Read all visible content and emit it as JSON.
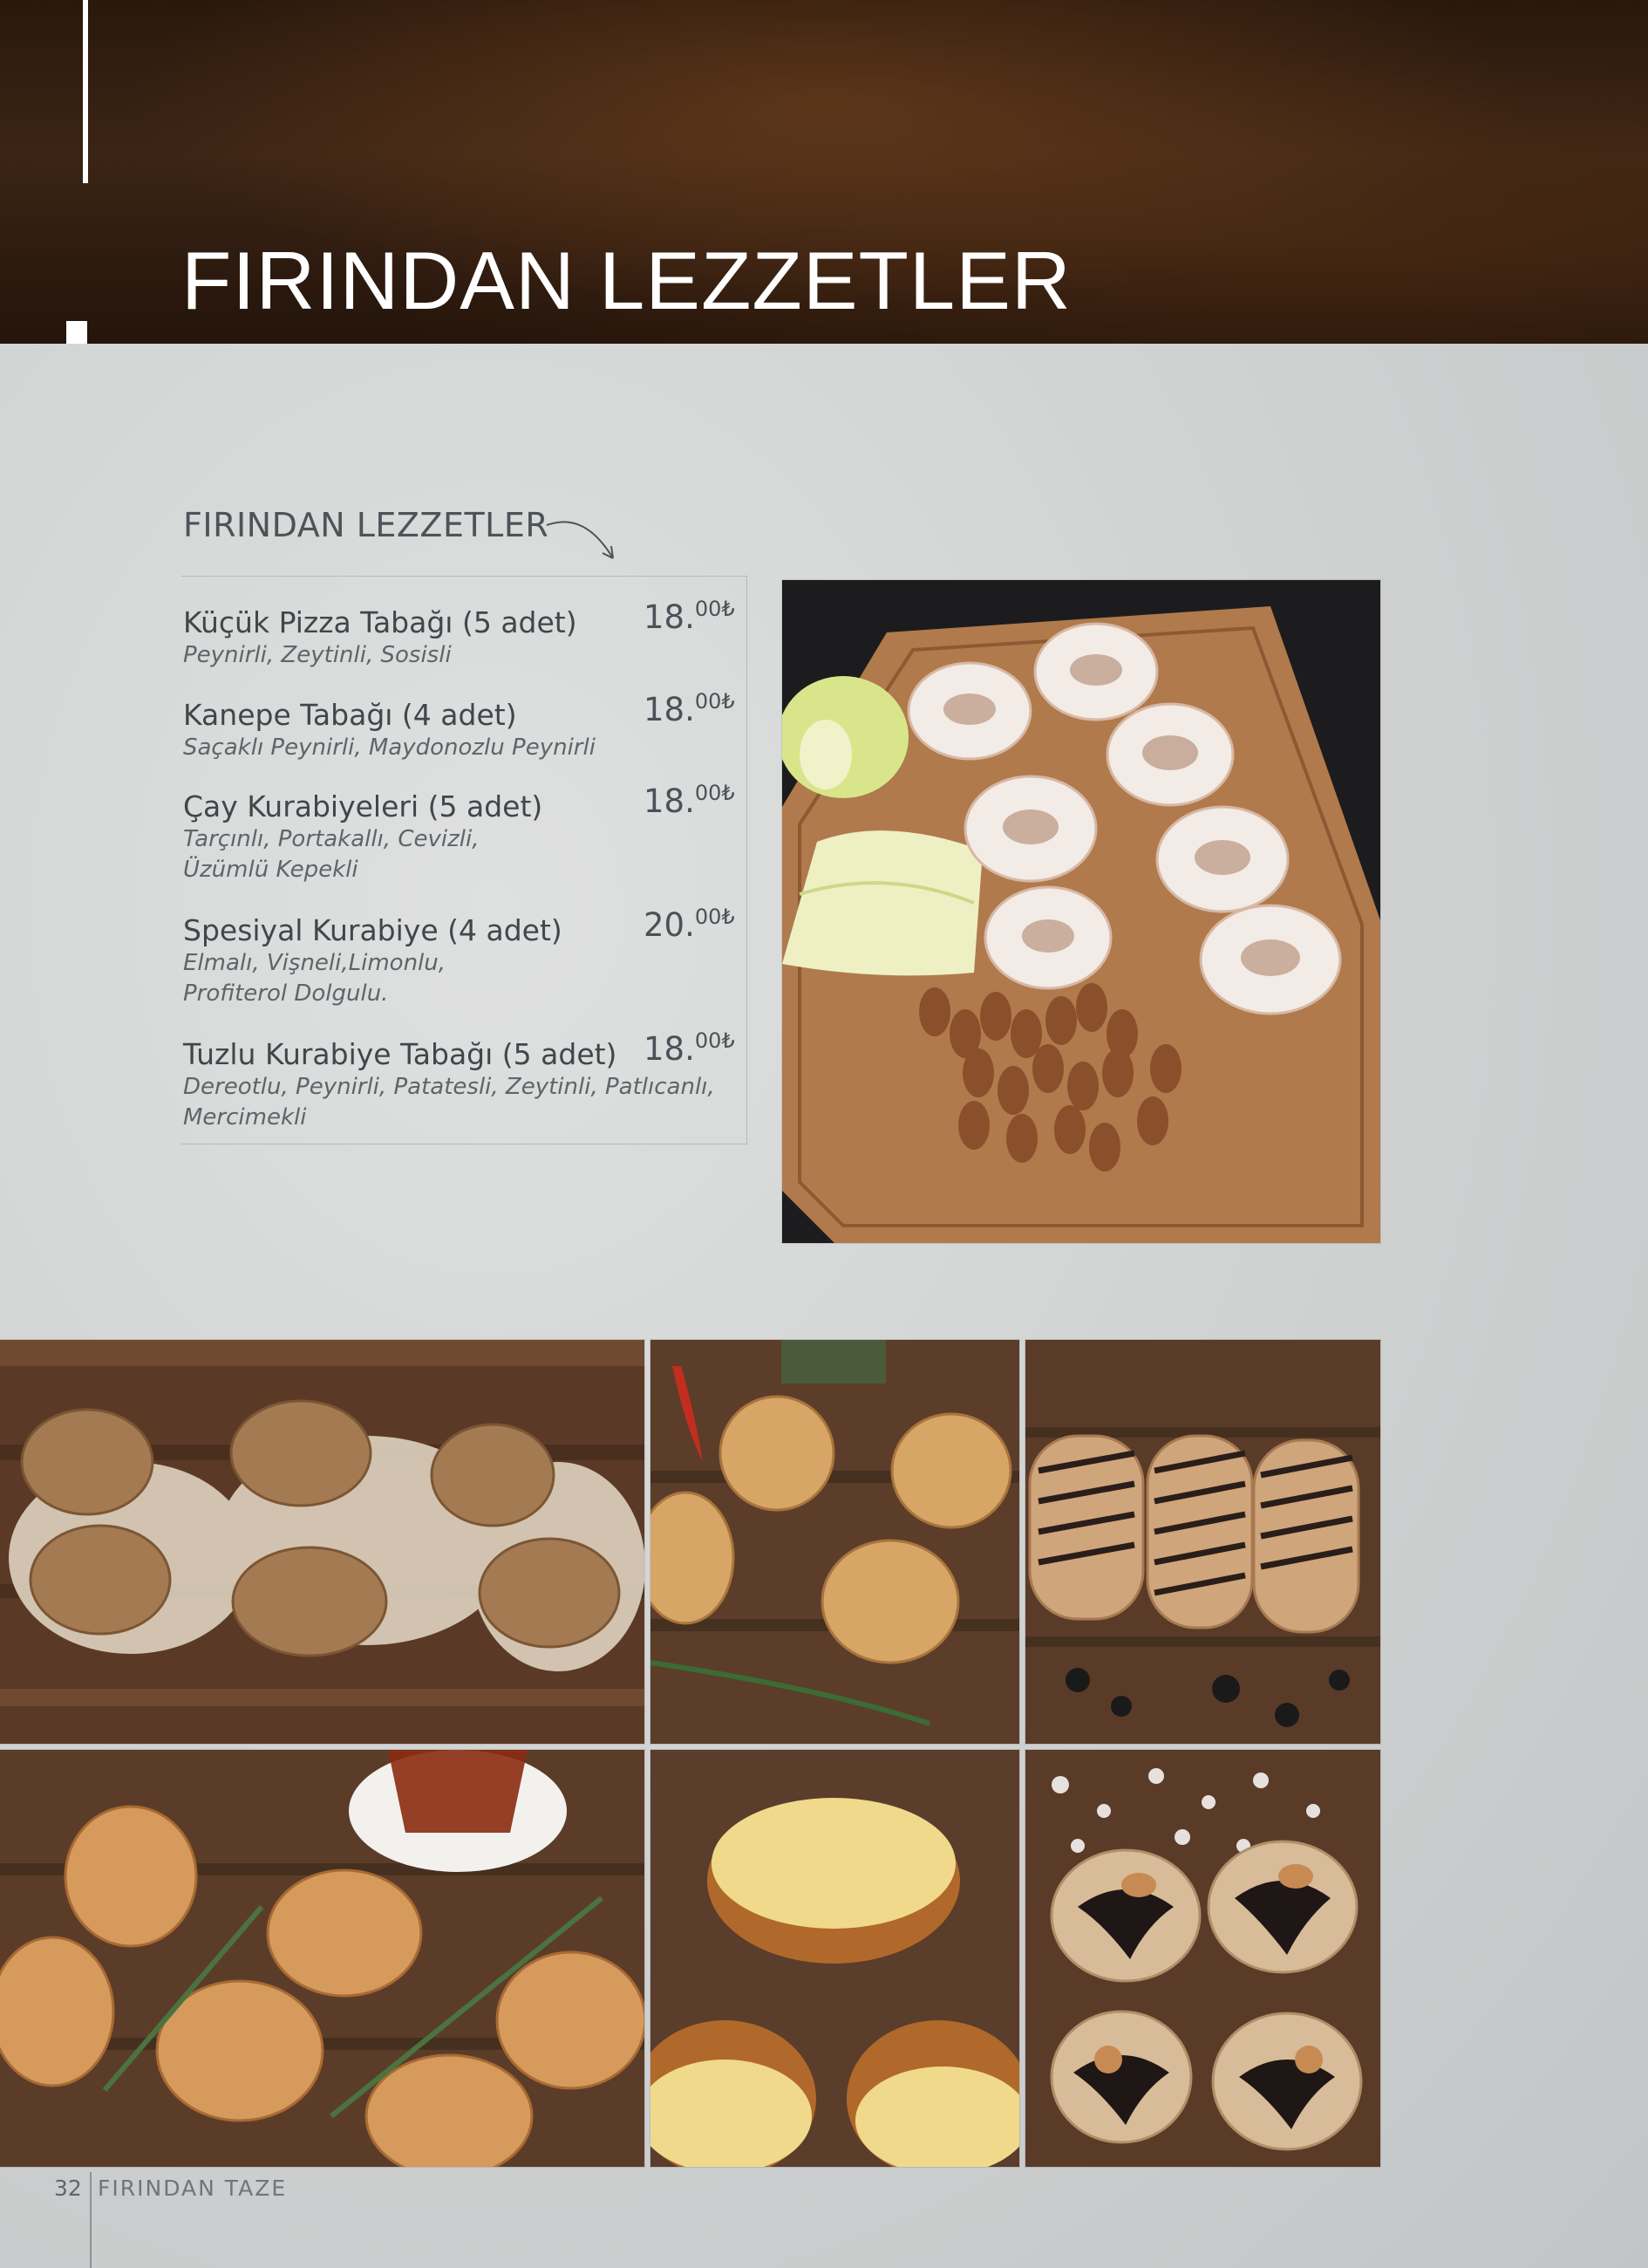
{
  "header": {
    "title": "FIRINDAN LEZZETLER"
  },
  "section": {
    "title": "FIRINDAN LEZZETLER"
  },
  "items": [
    {
      "name": "Küçük Pizza Tabağı (5 adet)",
      "desc": "Peynirli, Zeytinli, Sosisli",
      "price_main": "18.",
      "price_cents": "00₺"
    },
    {
      "name": "Kanepe Tabağı (4 adet)",
      "desc": "Saçaklı Peynirli, Maydonozlu Peynirli",
      "price_main": "18.",
      "price_cents": "00₺"
    },
    {
      "name": "Çay Kurabiyeleri (5 adet)",
      "desc": "Tarçınlı, Portakallı, Cevizli,\nÜzümlü Kepekli",
      "price_main": "18.",
      "price_cents": "00₺"
    },
    {
      "name": "Spesiyal Kurabiye (4 adet)",
      "desc": "Elmalı, Vişneli,Limonlu,\nProfiterol Dolgulu.",
      "price_main": "20.",
      "price_cents": "00₺"
    },
    {
      "name": "Tuzlu Kurabiye Tabağı (5 adet)",
      "desc": "Dereotlu, Peynirli, Patatesli, Zeytinli, Patlıcanlı,\nMercimekli",
      "price_main": "18.",
      "price_cents": "00₺"
    }
  ],
  "photos": [
    {
      "name": "meringue-cookies-board-photo",
      "subject": "meringue cookies, apple slices and almonds on wooden board"
    },
    {
      "name": "oat-cookies-photo",
      "subject": "oat topped cookies on wood"
    },
    {
      "name": "savory-pastries-photo",
      "subject": "savory pastries with rosemary and pepper"
    },
    {
      "name": "striped-finger-cookies-photo",
      "subject": "finger cookies with chocolate stripes"
    },
    {
      "name": "tea-cookies-photo",
      "subject": "glazed cookies with tea and rosemary"
    },
    {
      "name": "kadayif-buns-photo",
      "subject": "buns topped with shredded pastry"
    },
    {
      "name": "chocolate-nut-cookies-photo",
      "subject": "cookies with chocolate and nuts"
    }
  ],
  "footer": {
    "page_number": "32",
    "label": "FIRINDAN TAZE"
  },
  "colors": {
    "header_bg": "#3b2415",
    "page_bg": "#d6d8d8",
    "text": "#3f474b"
  }
}
